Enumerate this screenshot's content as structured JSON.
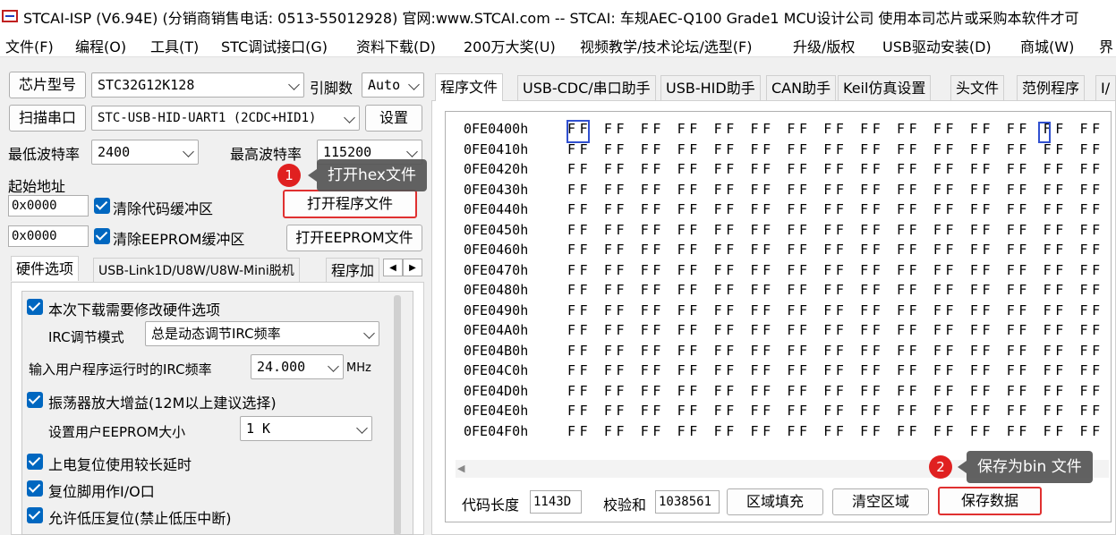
{
  "window": {
    "title": "STCAI-ISP (V6.94E) (分销商销售电话: 0513-55012928) 官网:www.STCAI.com  -- STCAI: 车规AEC-Q100 Grade1 MCU设计公司 使用本司芯片或采购本软件才可"
  },
  "menu": [
    "文件(F)",
    "编程(O)",
    "工具(T)",
    "STC调试接口(G)",
    "资料下载(D)",
    "200万大奖(U)",
    "视频教学/技术论坛/选型(F)",
    "升级/版权",
    "USB驱动安装(D)",
    "商城(W)",
    "界"
  ],
  "left": {
    "chip_label": "芯片型号",
    "chip_value": "STC32G12K128",
    "pin_label": "引脚数",
    "pin_value": "Auto",
    "scan_label": "扫描串口",
    "port_value": "STC-USB-HID-UART1 (2CDC+HID1)",
    "settings_label": "设置",
    "min_baud_label": "最低波特率",
    "min_baud_value": "2400",
    "max_baud_label": "最高波特率",
    "max_baud_value": "115200",
    "start_addr_label": "起始地址",
    "addr1": "0x0000",
    "clear_code_label": "清除代码缓冲区",
    "open_prog_label": "打开程序文件",
    "addr2": "0x0000",
    "clear_eeprom_label": "清除EEPROM缓冲区",
    "open_eeprom_label": "打开EEPROM文件",
    "tabs": [
      "硬件选项",
      "USB-Link1D/U8W/U8W-Mini脱机",
      "程序加"
    ],
    "hw": {
      "opt1": "本次下载需要修改硬件选项",
      "irc_mode_label": "IRC调节模式",
      "irc_mode_value": "总是动态调节IRC频率",
      "irc_freq_label": "输入用户程序运行时的IRC频率",
      "irc_freq_value": "24.000",
      "irc_unit": "MHz",
      "opt2": "振荡器放大增益(12M以上建议选择)",
      "eeprom_size_label": "设置用户EEPROM大小",
      "eeprom_size_value": "1   K",
      "opt3": "上电复位使用较长延时",
      "opt4": "复位脚用作I/O口",
      "opt5": "允许低压复位(禁止低压中断)"
    }
  },
  "right": {
    "tabs": [
      "程序文件",
      "USB-CDC/串口助手",
      "USB-HID助手",
      "CAN助手",
      "Keil仿真设置",
      "头文件",
      "范例程序",
      "I/"
    ],
    "hex_rows": [
      {
        "addr": "0FE0400h",
        "bytes": "FF FF FF FF FF FF FF FF FF FF FF FF FF FF FF FF"
      },
      {
        "addr": "0FE0410h",
        "bytes": "FF FF FF FF FF FF FF FF FF FF FF FF FF FF FF FF"
      },
      {
        "addr": "0FE0420h",
        "bytes": "FF FF FF FF FF FF FF FF FF FF FF FF FF FF FF FF"
      },
      {
        "addr": "0FE0430h",
        "bytes": "FF FF FF FF FF FF FF FF FF FF FF FF FF FF FF FF"
      },
      {
        "addr": "0FE0440h",
        "bytes": "FF FF FF FF FF FF FF FF FF FF FF FF FF FF FF FF"
      },
      {
        "addr": "0FE0450h",
        "bytes": "FF FF FF FF FF FF FF FF FF FF FF FF FF FF FF FF"
      },
      {
        "addr": "0FE0460h",
        "bytes": "FF FF FF FF FF FF FF FF FF FF FF FF FF FF FF FF"
      },
      {
        "addr": "0FE0470h",
        "bytes": "FF FF FF FF FF FF FF FF FF FF FF FF FF FF FF FF"
      },
      {
        "addr": "0FE0480h",
        "bytes": "FF FF FF FF FF FF FF FF FF FF FF FF FF FF FF FF"
      },
      {
        "addr": "0FE0490h",
        "bytes": "FF FF FF FF FF FF FF FF FF FF FF FF FF FF FF FF"
      },
      {
        "addr": "0FE04A0h",
        "bytes": "FF FF FF FF FF FF FF FF FF FF FF FF FF FF FF FF"
      },
      {
        "addr": "0FE04B0h",
        "bytes": "FF FF FF FF FF FF FF FF FF FF FF FF FF FF FF FF"
      },
      {
        "addr": "0FE04C0h",
        "bytes": "FF FF FF FF FF FF FF FF FF FF FF FF FF FF FF FF"
      },
      {
        "addr": "0FE04D0h",
        "bytes": "FF FF FF FF FF FF FF FF FF FF FF FF FF FF FF FF"
      },
      {
        "addr": "0FE04E0h",
        "bytes": "FF FF FF FF FF FF FF FF FF FF FF FF FF FF FF FF"
      },
      {
        "addr": "0FE04F0h",
        "bytes": "FF FF FF FF FF FF FF FF FF FF FF FF FF FF FF FF"
      }
    ],
    "code_len_label": "代码长度",
    "code_len_value": "1143D",
    "checksum_label": "校验和",
    "checksum_value": "1038561",
    "fill_label": "区域填充",
    "clear_label": "清空区域",
    "save_label": "保存数据"
  },
  "callouts": {
    "c1_num": "1",
    "c1_text": "打开hex文件",
    "c2_num": "2",
    "c2_text": "保存为bin 文件"
  },
  "colors": {
    "accent": "#0067c0",
    "highlight": "#e03030",
    "callout_bg": "#555555"
  }
}
